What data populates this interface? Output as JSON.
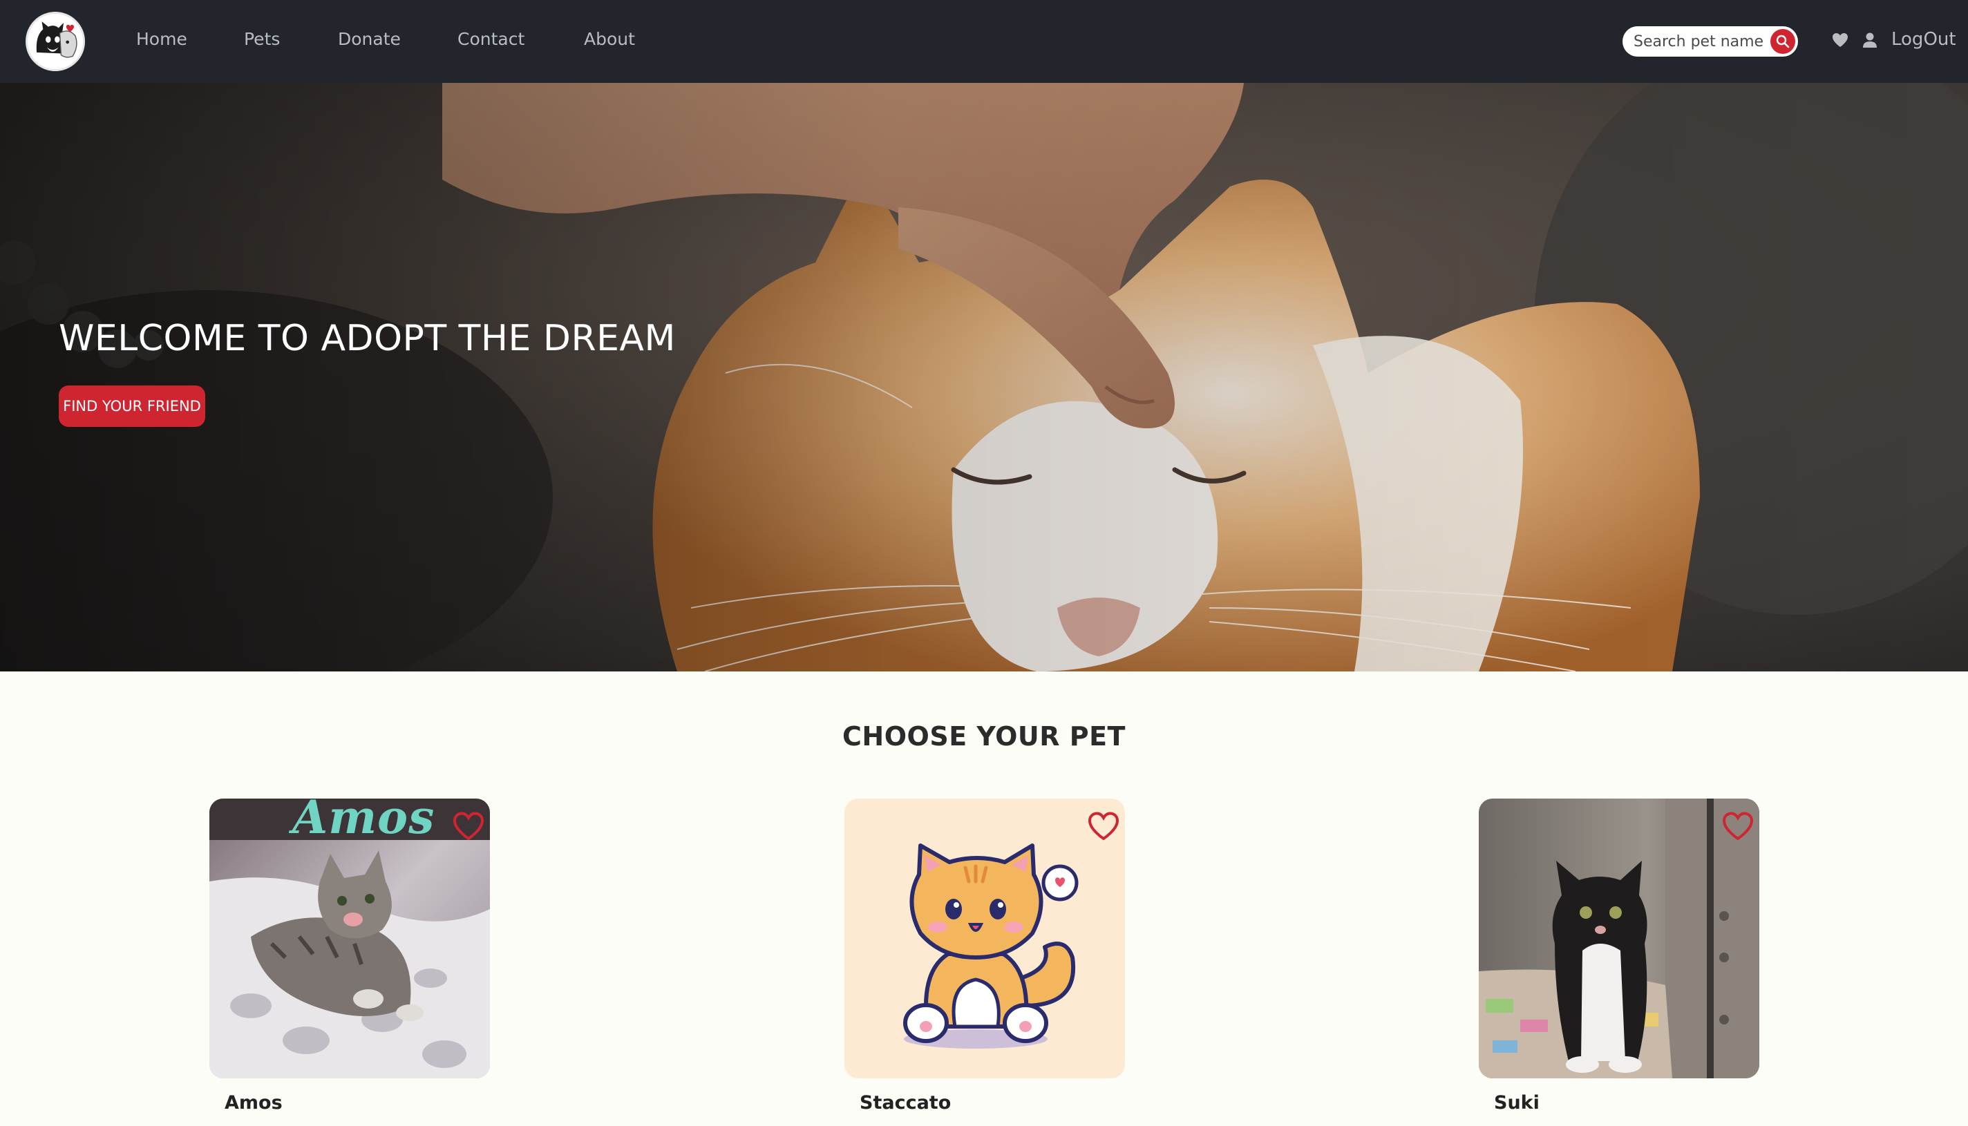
{
  "nav": {
    "links": [
      "Home",
      "Pets",
      "Donate",
      "Contact",
      "About"
    ],
    "search_placeholder": "Search pet name",
    "logout_label": "LogOut"
  },
  "hero": {
    "title": "WELCOME TO ADOPT THE DREAM",
    "button_label": "FIND YOUR FRIEND"
  },
  "pets_section": {
    "title": "CHOOSE YOUR PET",
    "pets": [
      {
        "name": "Amos",
        "image_caption": "Amos"
      },
      {
        "name": "Staccato"
      },
      {
        "name": "Suki"
      }
    ]
  },
  "colors": {
    "navbar": "#22262c",
    "accent": "#cf2531",
    "page_background": "#fdfdf7"
  }
}
